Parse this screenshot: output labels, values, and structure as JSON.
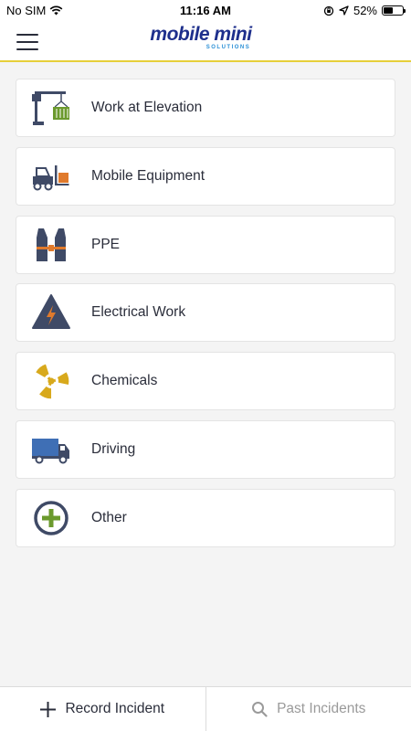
{
  "status_bar": {
    "carrier": "No SIM",
    "time": "11:16 AM",
    "battery_percent": "52%",
    "battery_level": 0.52
  },
  "header": {
    "logo_main": "mobile mini",
    "logo_sub": "SOLUTIONS",
    "accent_color": "#e6cf3a"
  },
  "categories": [
    {
      "label": "Work at Elevation",
      "icon": "crane-container-icon"
    },
    {
      "label": "Mobile Equipment",
      "icon": "forklift-icon"
    },
    {
      "label": "PPE",
      "icon": "safety-vest-icon"
    },
    {
      "label": "Electrical Work",
      "icon": "electrical-hazard-icon"
    },
    {
      "label": "Chemicals",
      "icon": "radiation-icon"
    },
    {
      "label": "Driving",
      "icon": "truck-icon"
    },
    {
      "label": "Other",
      "icon": "plus-circle-icon"
    }
  ],
  "bottom_bar": {
    "record_label": "Record Incident",
    "past_label": "Past Incidents"
  },
  "colors": {
    "navy": "#3f4a66",
    "green": "#6b9a2d",
    "orange": "#e07a2c",
    "yellow": "#d8a91c",
    "blue": "#3f6fb5"
  }
}
